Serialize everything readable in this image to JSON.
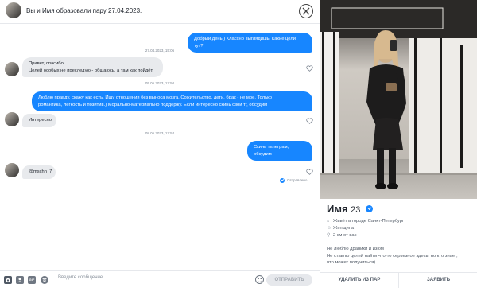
{
  "header": {
    "title": "Вы и Имя образовали пару 27.04.2023."
  },
  "messages": [
    {
      "type": "outgoing",
      "text": "Добрый день:) Классно выглядишь. Какие цели тут?"
    },
    {
      "type": "timestamp",
      "text": "27.04.2023, 15:06"
    },
    {
      "type": "incoming",
      "lines": [
        "Привет, спасибо",
        "Целей особых не преследую - общаюсь, а там как пойдёт"
      ]
    },
    {
      "type": "timestamp",
      "text": "05.05.2023, 17:50"
    },
    {
      "type": "outgoing",
      "lines": [
        "Люблю правду, скажу как есть. Ищу отношения без выноса мозга. Сожительство, дети, брак - не мое. Только",
        "романтика, легкость и позитив.) Морально-материально поддержу. Если интересно скинь свой тг, обсудим"
      ]
    },
    {
      "type": "incoming",
      "text": "Интересно"
    },
    {
      "type": "timestamp",
      "text": "08.05.2023, 17:54"
    },
    {
      "type": "outgoing",
      "text": "Скинь телеграм, обсудим"
    },
    {
      "type": "status",
      "text": "Отправлено"
    },
    {
      "type": "incoming",
      "text": "@mschh_7"
    }
  ],
  "composer": {
    "placeholder": "Введите сообщение",
    "gif_label": "GIF",
    "send_label": "ОТПРАВИТЬ"
  },
  "profile": {
    "name": "Имя",
    "age": "23",
    "facts": [
      {
        "icon": "house-icon",
        "text": "Живёт в городе Санкт-Петербург"
      },
      {
        "icon": "person-icon",
        "text": "Женщина"
      },
      {
        "icon": "location-icon",
        "text": "2 км от вас"
      }
    ],
    "bio": [
      "Не люблю драники и изюм",
      "Не ставлю целей найти что-то серьезное здесь, но кто знает,",
      "что может получиться)"
    ],
    "unmatch_label": "УДАЛИТЬ ИЗ ПАР",
    "report_label": "ЗАЯВИТЬ"
  },
  "colors": {
    "accent": "#1786ff",
    "incoming_bubble": "#e8eaed"
  }
}
